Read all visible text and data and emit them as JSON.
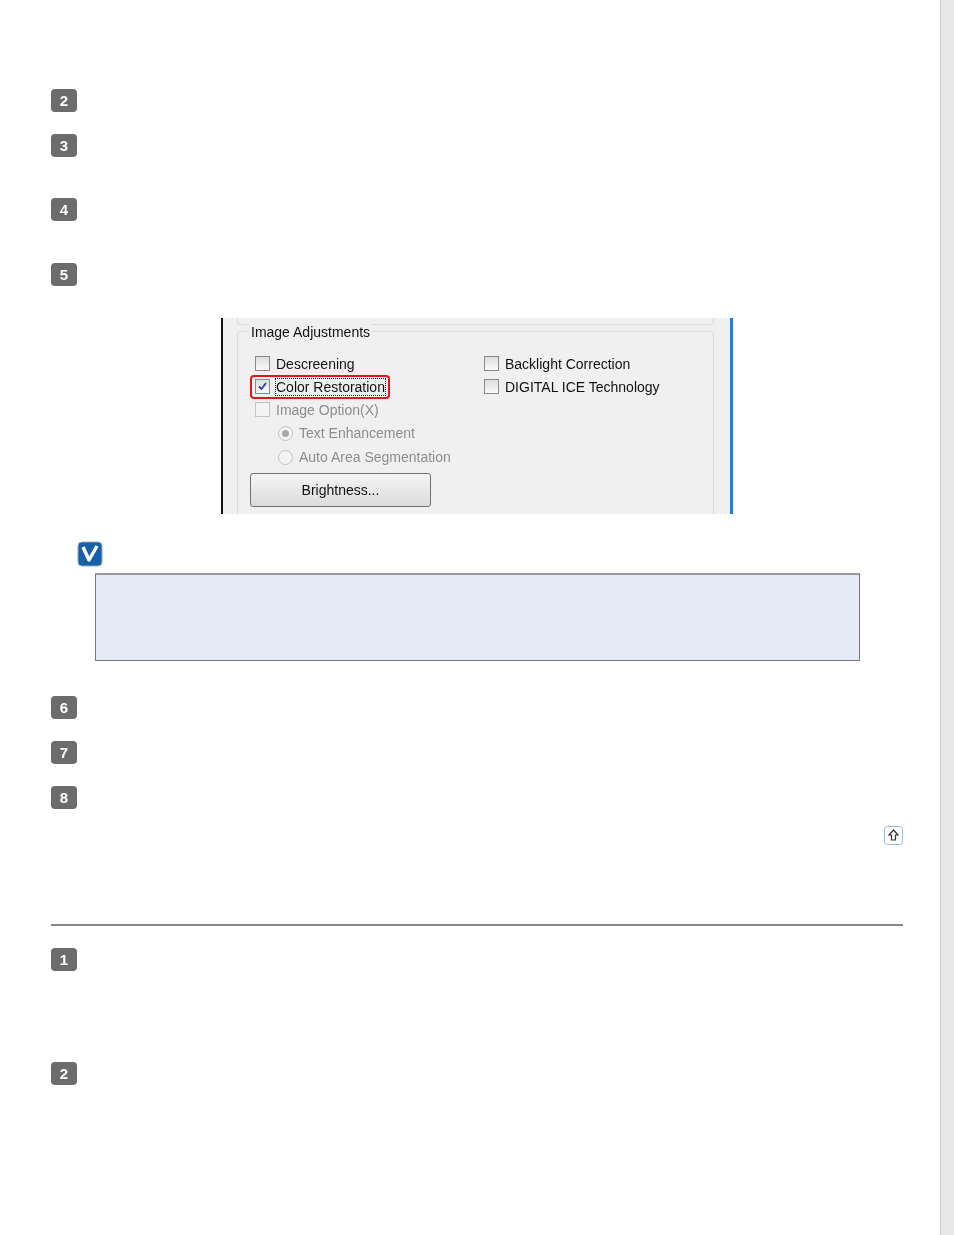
{
  "steps_a": [
    {
      "number": "2"
    },
    {
      "number": "3"
    },
    {
      "number": "4"
    },
    {
      "number": "5"
    }
  ],
  "dialog": {
    "group_title": "Image Adjustments",
    "left_column": [
      {
        "kind": "checkbox",
        "label": "Descreening",
        "checked": false,
        "disabled": false,
        "focused": false,
        "highlighted": false
      },
      {
        "kind": "checkbox",
        "label": "Color Restoration",
        "checked": true,
        "disabled": false,
        "focused": true,
        "highlighted": true
      },
      {
        "kind": "checkbox",
        "label": "Image Option(X)",
        "checked": false,
        "disabled": true,
        "focused": false,
        "highlighted": false
      },
      {
        "kind": "radio",
        "label": "Text Enhancement",
        "selected": true,
        "disabled": true
      },
      {
        "kind": "radio",
        "label": "Auto Area Segmentation",
        "selected": false,
        "disabled": true
      }
    ],
    "right_column": [
      {
        "kind": "checkbox",
        "label": "Backlight Correction",
        "checked": false,
        "disabled": false,
        "focused": false,
        "highlighted": false
      },
      {
        "kind": "checkbox",
        "label": "DIGITAL ICE Technology",
        "checked": false,
        "disabled": false,
        "focused": false,
        "highlighted": false
      }
    ],
    "button": "Brightness..."
  },
  "steps_b": [
    {
      "number": "6"
    },
    {
      "number": "7"
    },
    {
      "number": "8"
    }
  ],
  "steps_c": [
    {
      "number": "1"
    },
    {
      "number": "2"
    }
  ]
}
